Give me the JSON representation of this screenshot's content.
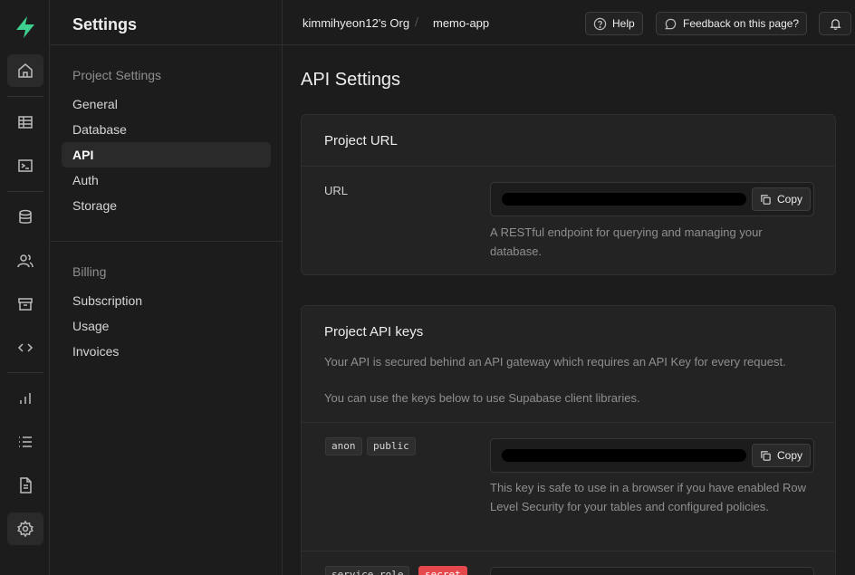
{
  "app": {
    "title": "Settings"
  },
  "sidebar": {
    "groups": [
      {
        "label": "Project Settings",
        "items": [
          "General",
          "Database",
          "API",
          "Auth",
          "Storage"
        ],
        "active": "API"
      },
      {
        "label": "Billing",
        "items": [
          "Subscription",
          "Usage",
          "Invoices"
        ]
      }
    ]
  },
  "rail": [
    "home-icon",
    "table-icon",
    "terminal-icon",
    "database-icon",
    "users-icon",
    "archive-icon",
    "code-icon",
    "bar-chart-icon",
    "list-icon",
    "document-icon",
    "gear-icon"
  ],
  "topbar": {
    "org": "kimmihyeon12's Org",
    "separator": "/",
    "project": "memo-app",
    "help_label": "Help",
    "feedback_label": "Feedback on this page?"
  },
  "main": {
    "title": "API Settings",
    "project_url": {
      "heading": "Project URL",
      "url_label": "URL",
      "copy_label": "Copy",
      "hint": "A RESTful endpoint for querying and managing your database."
    },
    "api_keys": {
      "heading": "Project API keys",
      "desc_line1": "Your API is secured behind an API gateway which requires an API Key for every request.",
      "desc_line2": "You can use the keys below to use Supabase client libraries.",
      "anon_badge": "anon",
      "public_badge": "public",
      "copy_label": "Copy",
      "anon_hint": "This key is safe to use in a browser if you have enabled Row Level Security for your tables and configured policies.",
      "service_badge": "service_role",
      "secret_badge": "secret"
    }
  },
  "colors": {
    "accent": "#3ecf8e",
    "danger": "#e5484d",
    "bg": "#1c1c1c",
    "card": "#232323"
  }
}
